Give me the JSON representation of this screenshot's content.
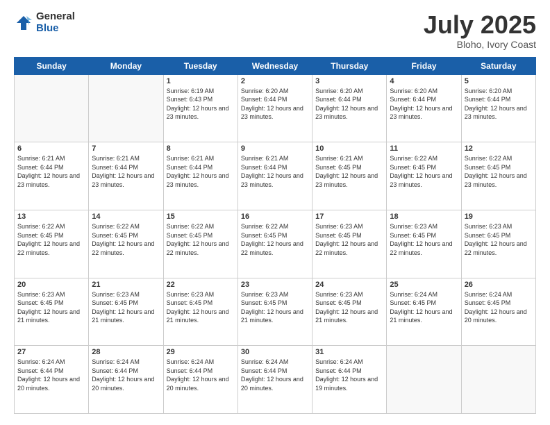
{
  "logo": {
    "general": "General",
    "blue": "Blue"
  },
  "header": {
    "month": "July 2025",
    "location": "Bloho, Ivory Coast"
  },
  "weekdays": [
    "Sunday",
    "Monday",
    "Tuesday",
    "Wednesday",
    "Thursday",
    "Friday",
    "Saturday"
  ],
  "weeks": [
    [
      {
        "day": "",
        "info": ""
      },
      {
        "day": "",
        "info": ""
      },
      {
        "day": "1",
        "info": "Sunrise: 6:19 AM\nSunset: 6:43 PM\nDaylight: 12 hours and 23 minutes."
      },
      {
        "day": "2",
        "info": "Sunrise: 6:20 AM\nSunset: 6:44 PM\nDaylight: 12 hours and 23 minutes."
      },
      {
        "day": "3",
        "info": "Sunrise: 6:20 AM\nSunset: 6:44 PM\nDaylight: 12 hours and 23 minutes."
      },
      {
        "day": "4",
        "info": "Sunrise: 6:20 AM\nSunset: 6:44 PM\nDaylight: 12 hours and 23 minutes."
      },
      {
        "day": "5",
        "info": "Sunrise: 6:20 AM\nSunset: 6:44 PM\nDaylight: 12 hours and 23 minutes."
      }
    ],
    [
      {
        "day": "6",
        "info": "Sunrise: 6:21 AM\nSunset: 6:44 PM\nDaylight: 12 hours and 23 minutes."
      },
      {
        "day": "7",
        "info": "Sunrise: 6:21 AM\nSunset: 6:44 PM\nDaylight: 12 hours and 23 minutes."
      },
      {
        "day": "8",
        "info": "Sunrise: 6:21 AM\nSunset: 6:44 PM\nDaylight: 12 hours and 23 minutes."
      },
      {
        "day": "9",
        "info": "Sunrise: 6:21 AM\nSunset: 6:44 PM\nDaylight: 12 hours and 23 minutes."
      },
      {
        "day": "10",
        "info": "Sunrise: 6:21 AM\nSunset: 6:45 PM\nDaylight: 12 hours and 23 minutes."
      },
      {
        "day": "11",
        "info": "Sunrise: 6:22 AM\nSunset: 6:45 PM\nDaylight: 12 hours and 23 minutes."
      },
      {
        "day": "12",
        "info": "Sunrise: 6:22 AM\nSunset: 6:45 PM\nDaylight: 12 hours and 23 minutes."
      }
    ],
    [
      {
        "day": "13",
        "info": "Sunrise: 6:22 AM\nSunset: 6:45 PM\nDaylight: 12 hours and 22 minutes."
      },
      {
        "day": "14",
        "info": "Sunrise: 6:22 AM\nSunset: 6:45 PM\nDaylight: 12 hours and 22 minutes."
      },
      {
        "day": "15",
        "info": "Sunrise: 6:22 AM\nSunset: 6:45 PM\nDaylight: 12 hours and 22 minutes."
      },
      {
        "day": "16",
        "info": "Sunrise: 6:22 AM\nSunset: 6:45 PM\nDaylight: 12 hours and 22 minutes."
      },
      {
        "day": "17",
        "info": "Sunrise: 6:23 AM\nSunset: 6:45 PM\nDaylight: 12 hours and 22 minutes."
      },
      {
        "day": "18",
        "info": "Sunrise: 6:23 AM\nSunset: 6:45 PM\nDaylight: 12 hours and 22 minutes."
      },
      {
        "day": "19",
        "info": "Sunrise: 6:23 AM\nSunset: 6:45 PM\nDaylight: 12 hours and 22 minutes."
      }
    ],
    [
      {
        "day": "20",
        "info": "Sunrise: 6:23 AM\nSunset: 6:45 PM\nDaylight: 12 hours and 21 minutes."
      },
      {
        "day": "21",
        "info": "Sunrise: 6:23 AM\nSunset: 6:45 PM\nDaylight: 12 hours and 21 minutes."
      },
      {
        "day": "22",
        "info": "Sunrise: 6:23 AM\nSunset: 6:45 PM\nDaylight: 12 hours and 21 minutes."
      },
      {
        "day": "23",
        "info": "Sunrise: 6:23 AM\nSunset: 6:45 PM\nDaylight: 12 hours and 21 minutes."
      },
      {
        "day": "24",
        "info": "Sunrise: 6:23 AM\nSunset: 6:45 PM\nDaylight: 12 hours and 21 minutes."
      },
      {
        "day": "25",
        "info": "Sunrise: 6:24 AM\nSunset: 6:45 PM\nDaylight: 12 hours and 21 minutes."
      },
      {
        "day": "26",
        "info": "Sunrise: 6:24 AM\nSunset: 6:45 PM\nDaylight: 12 hours and 20 minutes."
      }
    ],
    [
      {
        "day": "27",
        "info": "Sunrise: 6:24 AM\nSunset: 6:44 PM\nDaylight: 12 hours and 20 minutes."
      },
      {
        "day": "28",
        "info": "Sunrise: 6:24 AM\nSunset: 6:44 PM\nDaylight: 12 hours and 20 minutes."
      },
      {
        "day": "29",
        "info": "Sunrise: 6:24 AM\nSunset: 6:44 PM\nDaylight: 12 hours and 20 minutes."
      },
      {
        "day": "30",
        "info": "Sunrise: 6:24 AM\nSunset: 6:44 PM\nDaylight: 12 hours and 20 minutes."
      },
      {
        "day": "31",
        "info": "Sunrise: 6:24 AM\nSunset: 6:44 PM\nDaylight: 12 hours and 19 minutes."
      },
      {
        "day": "",
        "info": ""
      },
      {
        "day": "",
        "info": ""
      }
    ]
  ]
}
